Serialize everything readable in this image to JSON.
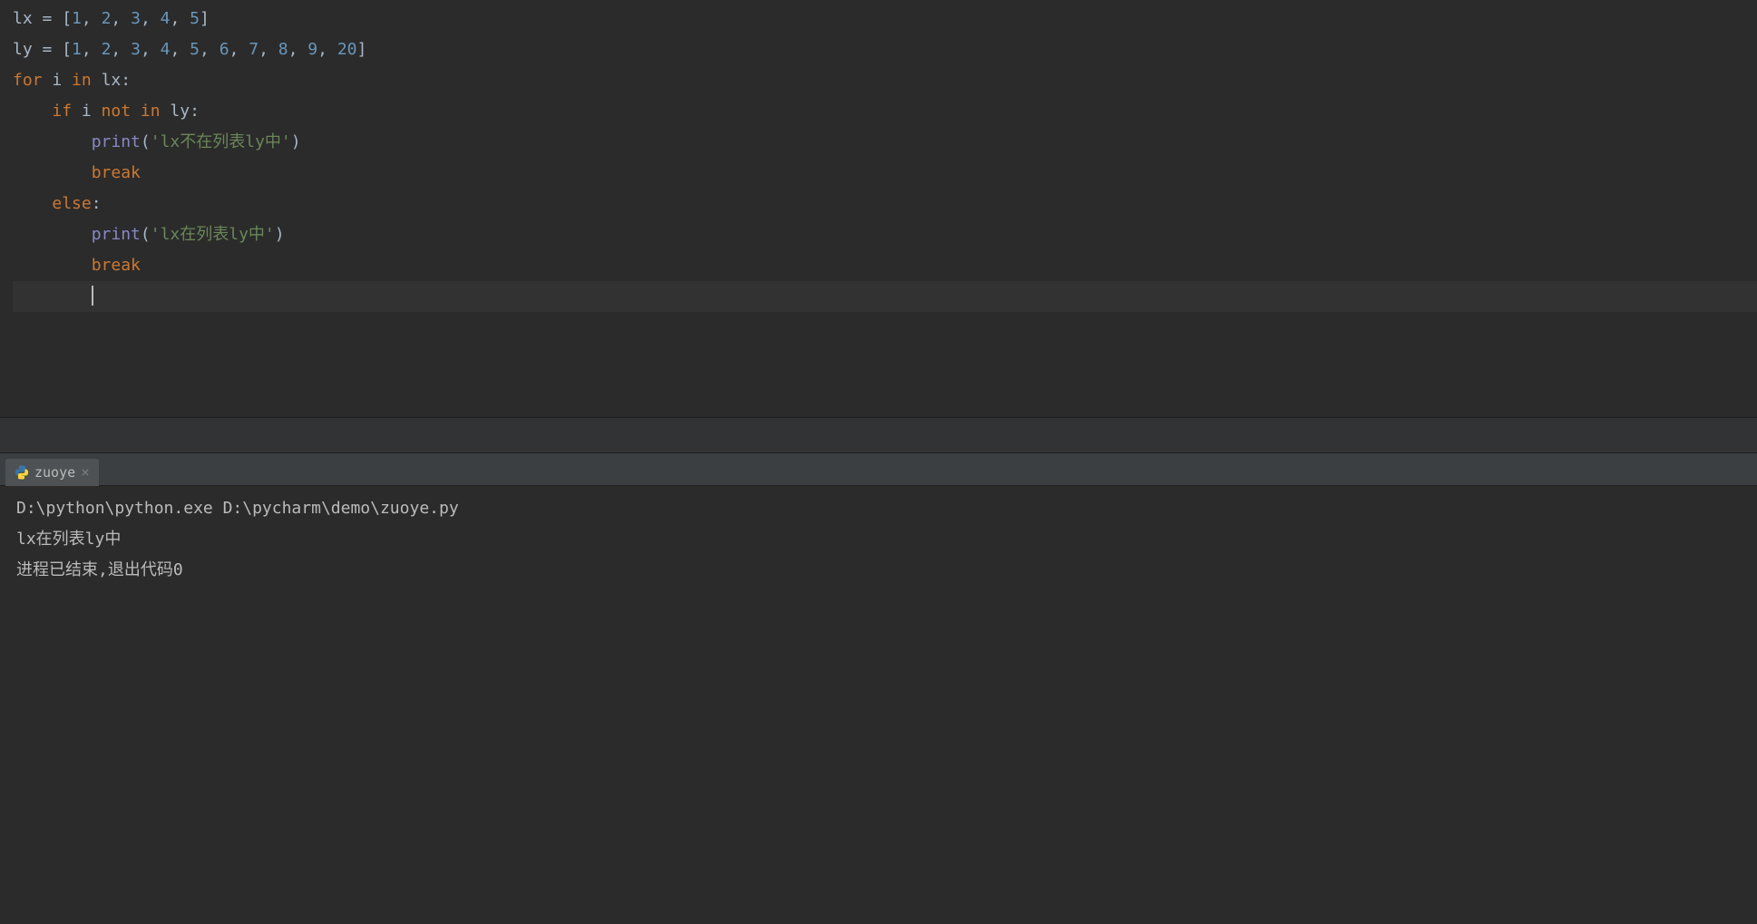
{
  "code": {
    "line1": {
      "lx": "lx",
      "eq": " = ",
      "open": "[",
      "n1": "1",
      "c1": ", ",
      "n2": "2",
      "c2": ", ",
      "n3": "3",
      "c3": ", ",
      "n4": "4",
      "c4": ", ",
      "n5": "5",
      "close": "]"
    },
    "line2": {
      "ly": "ly",
      "eq": " = ",
      "open": "[",
      "n1": "1",
      "c1": ", ",
      "n2": "2",
      "c2": ", ",
      "n3": "3",
      "c3": ", ",
      "n4": "4",
      "c4": ", ",
      "n5": "5",
      "c5": ", ",
      "n6": "6",
      "c6": ", ",
      "n7": "7",
      "c7": ", ",
      "n8": "8",
      "c8": ", ",
      "n9": "9",
      "c9": ", ",
      "n10": "20",
      "close": "]"
    },
    "line3": {
      "for": "for ",
      "i": "i",
      "in": " in ",
      "lx": "lx:"
    },
    "line4": {
      "pad": "    ",
      "if": "if ",
      "i": "i",
      "notin": " not in ",
      "ly": "ly:"
    },
    "line5": {
      "pad": "        ",
      "print": "print",
      "open": "(",
      "str": "'lx不在列表ly中'",
      "close": ")"
    },
    "line6": {
      "pad": "        ",
      "break": "break"
    },
    "line7": {
      "pad": "    ",
      "else": "else",
      "colon": ":"
    },
    "line8": {
      "pad": "        ",
      "print": "print",
      "open": "(",
      "str": "'lx在列表ly中'",
      "close": ")"
    },
    "line9": {
      "pad": "        ",
      "break": "break"
    },
    "line10": {
      "pad": "        "
    }
  },
  "runTab": {
    "label": "zuoye"
  },
  "console": {
    "line1": "D:\\python\\python.exe D:\\pycharm\\demo\\zuoye.py",
    "line2": "lx在列表ly中",
    "line3": "",
    "line4": "进程已结束,退出代码0"
  }
}
